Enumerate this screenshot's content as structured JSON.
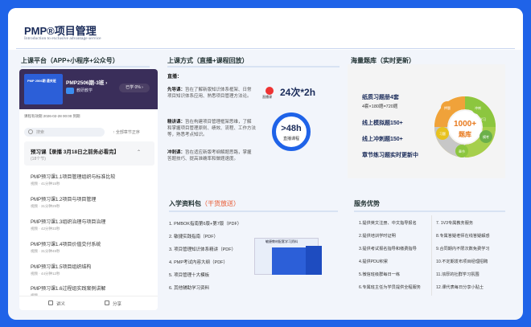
{
  "header": {
    "title": "PMP®项目管理",
    "subtitle": "Introduction to exclusive advantage service"
  },
  "sections": {
    "platform": "上课平台（APP+小程序+公众号）",
    "method": "上课方式（直播+课程回放）",
    "bank": "海量题库（实时更新）",
    "material": "入学资料包",
    "material_hl": "（干货放送）",
    "service": "服务优势"
  },
  "platform": {
    "banner_thumb": "PMP 2506期 通关班",
    "course_title": "PMP2506期-3班 ›",
    "teacher": "教研教学",
    "progress": "已学 0% ›",
    "valid_until": "课程有效期 2026-02-28 00:00 到期",
    "search_placeholder": "搜索",
    "sort_label": "↑ 全部章节正序",
    "chapter_title": "预习课【录播 3月18日之前务必看完】",
    "chapter_count": "(18个节)",
    "lessons": [
      {
        "title": "PMP预习课1.1项目管理组织与标准比较",
        "sub": "视频 · 41分钟15秒"
      },
      {
        "title": "PMP预习课1.2项目与项目管理",
        "sub": "视频 · 31分钟29秒"
      },
      {
        "title": "PMP预习课1.3组织治理与项目治理",
        "sub": "视频 · 42分钟33秒"
      },
      {
        "title": "PMP预习课1.4项目价值交付系统",
        "sub": "视频 · 31分钟49秒"
      },
      {
        "title": "PMP预习课1.5项目组织结构",
        "sub": "视频 · 44分钟12秒"
      },
      {
        "title": "PMP预习课1.6过程组实践案例讲解",
        "sub": "视频"
      }
    ],
    "footer": {
      "handout": "讲义",
      "share": "分享"
    }
  },
  "method": {
    "live_label": "直播：",
    "paragraphs": [
      {
        "label": "先导课：",
        "text": "旨在了解新版知识体系框架、日常项目知识体系应用、熟悉项目管理方法论。"
      },
      {
        "label": "精讲课：",
        "text": "旨在构建项目管理框架思维，了解和掌握项目管理原则、绩效、流程、工作方法等，熟悉考点知识。"
      },
      {
        "label": "冲刺课：",
        "text": "旨在适应新版考纲解题思路，掌握答题技巧、提高准确率和做题速度。"
      }
    ],
    "logo_text": "直播课",
    "hours": "24次*2h",
    "circle_main": ">48h",
    "circle_sub": "直播课程"
  },
  "bank": {
    "lines": [
      {
        "text": "纸质习题册4套",
        "bold": true
      },
      {
        "text": "4套×180题=720题",
        "bold": false
      },
      {
        "text": "线上模拟题150+",
        "bold": true
      },
      {
        "text": "线上冲刺题150+",
        "bold": true
      },
      {
        "text": "章节练习题实时更新中",
        "bold": true
      }
    ],
    "donut_main": "1000+",
    "donut_sub": "题库",
    "donut_segments": [
      "冲刺",
      "模考",
      "章节",
      "习题",
      "押题",
      "学习"
    ],
    "colors": {
      "green": "#8cc63f",
      "yellow": "#e8c21e",
      "orange": "#f0a23a",
      "gray": "#c7c7c7"
    }
  },
  "material": {
    "items": [
      "1. PMBOK指南第6版+第7版（PDF）",
      "2. 敏捷实践指南（PDF）",
      "3. 项目管理知识体系精讲（PDF）",
      "4. PMP考试内容大纲（PDF）",
      "5. 项目管理十大模板",
      "6. 其他辅助学习资料"
    ],
    "book_title": "敏捷教材配套学习资料"
  },
  "service": {
    "left": [
      "1.提供英文注册、中文指导报名",
      "2.提供培训学时证明",
      "3.提供考试报名指导和缴费指导",
      "4.提供PDU积累",
      "5.微信班级群每日一练",
      "6.专属班主任为学员提供全程服务"
    ],
    "right": [
      "7. 1V3专属教务服务",
      "8.专属答疑老师在线答疑解惑",
      "9.合同期内不限次数免费学习",
      "10.不定期发布项目经理招聘",
      "11.浓厚的社群学习氛围",
      "12.课代表每日分享小贴士"
    ]
  },
  "colors": {
    "accent": "#1f63e8",
    "dark": "#1b2c5a",
    "highlight": "#e8542a"
  }
}
